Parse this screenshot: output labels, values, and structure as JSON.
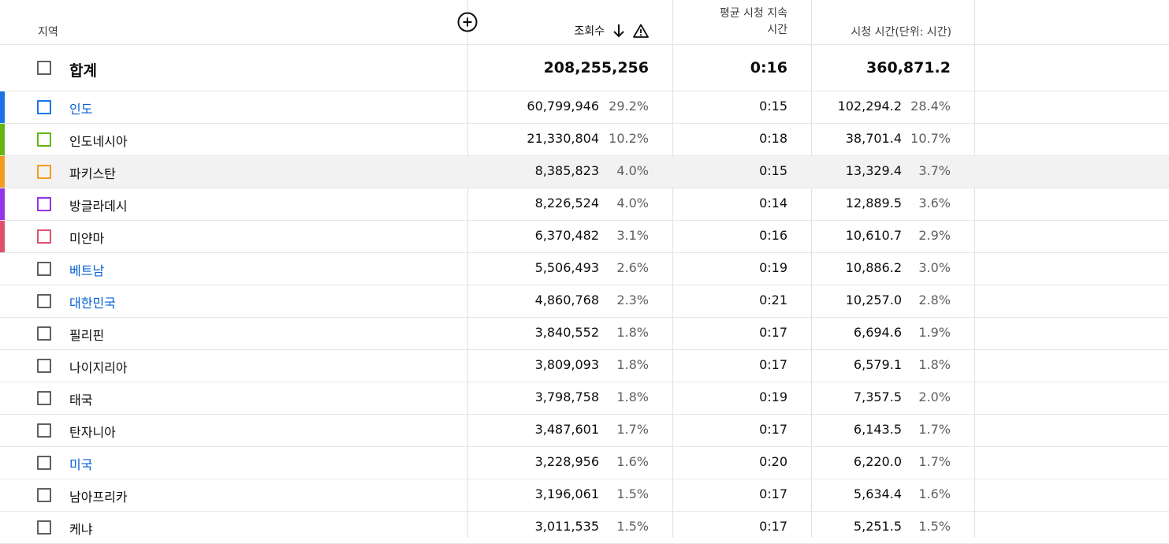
{
  "columns": {
    "region": "지역",
    "views": "조회수",
    "avg_duration_line1": "평균 시청 지속",
    "avg_duration_line2": "시간",
    "watch_time": "시청 시간(단위: 시간)"
  },
  "icons": {
    "add_column": "add-circle-icon",
    "sort": "arrow-down-icon",
    "warning": "warning-icon"
  },
  "total": {
    "label": "합계",
    "views": "208,255,256",
    "avg": "0:16",
    "watch": "360,871.2"
  },
  "rows": [
    {
      "name": "인도",
      "link": true,
      "color": "#1a73e8",
      "views": "60,799,946",
      "views_pct": "29.2%",
      "avg": "0:15",
      "watch": "102,294.2",
      "watch_pct": "28.4%"
    },
    {
      "name": "인도네시아",
      "link": false,
      "color": "#66b50f",
      "views": "21,330,804",
      "views_pct": "10.2%",
      "avg": "0:18",
      "watch": "38,701.4",
      "watch_pct": "10.7%"
    },
    {
      "name": "파키스탄",
      "link": false,
      "color": "#f29c1f",
      "views": "8,385,823",
      "views_pct": "4.0%",
      "avg": "0:15",
      "watch": "13,329.4",
      "watch_pct": "3.7%",
      "highlight": true
    },
    {
      "name": "방글라데시",
      "link": false,
      "color": "#9334e6",
      "views": "8,226,524",
      "views_pct": "4.0%",
      "avg": "0:14",
      "watch": "12,889.5",
      "watch_pct": "3.6%"
    },
    {
      "name": "미얀마",
      "link": false,
      "color": "#e0506e",
      "views": "6,370,482",
      "views_pct": "3.1%",
      "avg": "0:16",
      "watch": "10,610.7",
      "watch_pct": "2.9%"
    },
    {
      "name": "베트남",
      "link": true,
      "color": "",
      "views": "5,506,493",
      "views_pct": "2.6%",
      "avg": "0:19",
      "watch": "10,886.2",
      "watch_pct": "3.0%"
    },
    {
      "name": "대한민국",
      "link": true,
      "color": "",
      "views": "4,860,768",
      "views_pct": "2.3%",
      "avg": "0:21",
      "watch": "10,257.0",
      "watch_pct": "2.8%"
    },
    {
      "name": "필리핀",
      "link": false,
      "color": "",
      "views": "3,840,552",
      "views_pct": "1.8%",
      "avg": "0:17",
      "watch": "6,694.6",
      "watch_pct": "1.9%"
    },
    {
      "name": "나이지리아",
      "link": false,
      "color": "",
      "views": "3,809,093",
      "views_pct": "1.8%",
      "avg": "0:17",
      "watch": "6,579.1",
      "watch_pct": "1.8%"
    },
    {
      "name": "태국",
      "link": false,
      "color": "",
      "views": "3,798,758",
      "views_pct": "1.8%",
      "avg": "0:19",
      "watch": "7,357.5",
      "watch_pct": "2.0%"
    },
    {
      "name": "탄자니아",
      "link": false,
      "color": "",
      "views": "3,487,601",
      "views_pct": "1.7%",
      "avg": "0:17",
      "watch": "6,143.5",
      "watch_pct": "1.7%"
    },
    {
      "name": "미국",
      "link": true,
      "color": "",
      "views": "3,228,956",
      "views_pct": "1.6%",
      "avg": "0:20",
      "watch": "6,220.0",
      "watch_pct": "1.7%"
    },
    {
      "name": "남아프리카",
      "link": false,
      "color": "",
      "views": "3,196,061",
      "views_pct": "1.5%",
      "avg": "0:17",
      "watch": "5,634.4",
      "watch_pct": "1.6%"
    },
    {
      "name": "케냐",
      "link": false,
      "color": "",
      "views": "3,011,535",
      "views_pct": "1.5%",
      "avg": "0:17",
      "watch": "5,251.5",
      "watch_pct": "1.5%"
    }
  ]
}
